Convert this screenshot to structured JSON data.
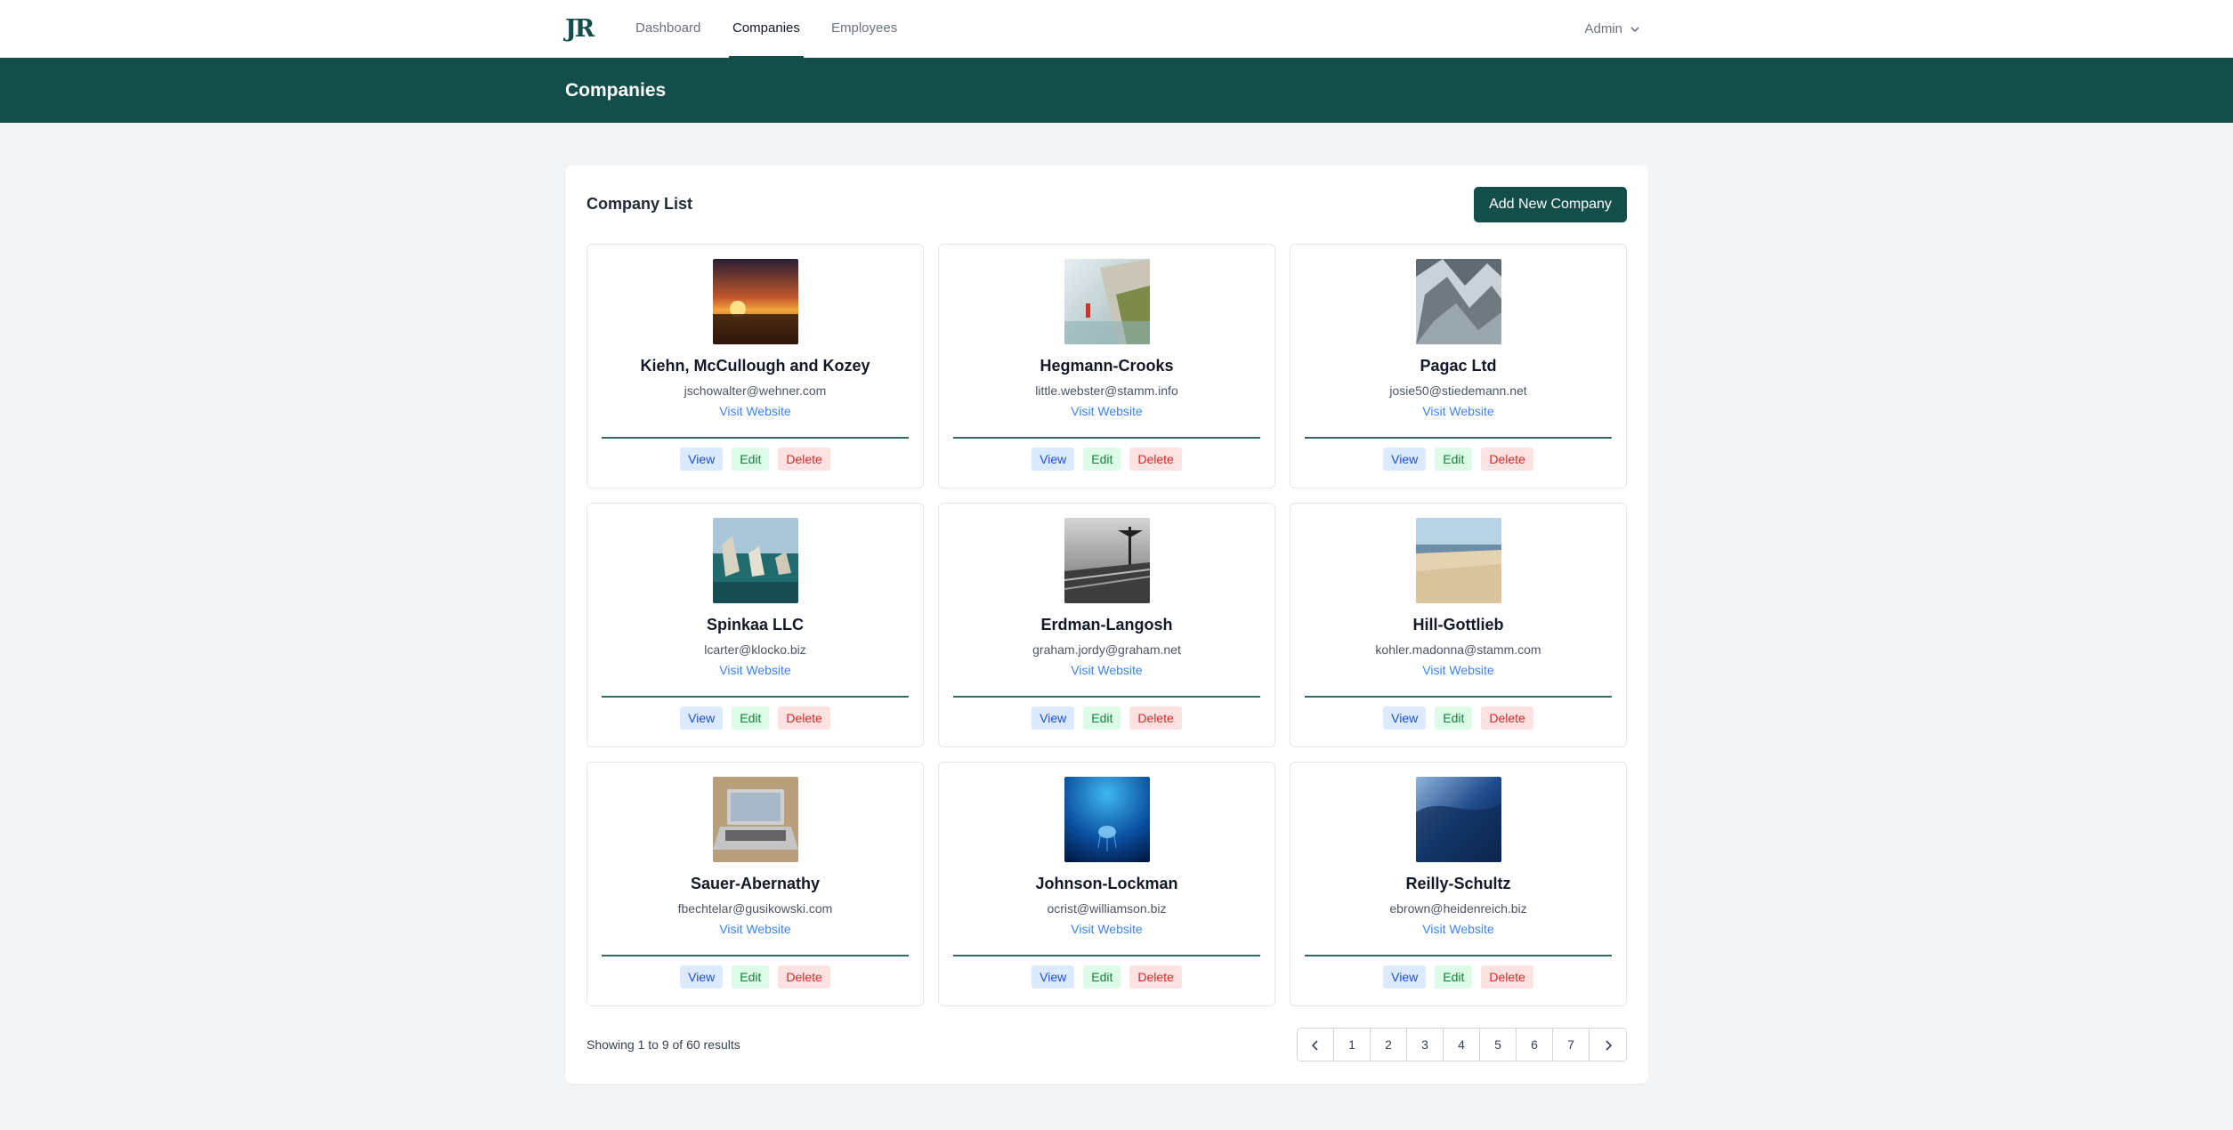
{
  "nav": {
    "logo": "JR",
    "links": [
      "Dashboard",
      "Companies",
      "Employees"
    ],
    "active": "Companies",
    "user": "Admin"
  },
  "header": {
    "title": "Companies"
  },
  "panel": {
    "title": "Company List",
    "add_button": "Add New Company",
    "cards": [
      {
        "name": "Kiehn, McCullough and Kozey",
        "email": "jschowalter@wehner.com",
        "link": "Visit Website",
        "image": "sunset-beach"
      },
      {
        "name": "Hegmann-Crooks",
        "email": "little.webster@stamm.info",
        "link": "Visit Website",
        "image": "cliff-lighthouse"
      },
      {
        "name": "Pagac Ltd",
        "email": "josie50@stiedemann.net",
        "link": "Visit Website",
        "image": "snowy-mountains"
      },
      {
        "name": "Spinkaa LLC",
        "email": "lcarter@klocko.biz",
        "link": "Visit Website",
        "image": "sea-rocks"
      },
      {
        "name": "Erdman-Langosh",
        "email": "graham.jordy@graham.net",
        "link": "Visit Website",
        "image": "pier-bw"
      },
      {
        "name": "Hill-Gottlieb",
        "email": "kohler.madonna@stamm.com",
        "link": "Visit Website",
        "image": "sandy-beach"
      },
      {
        "name": "Sauer-Abernathy",
        "email": "fbechtelar@gusikowski.com",
        "link": "Visit Website",
        "image": "laptop-desk"
      },
      {
        "name": "Johnson-Lockman",
        "email": "ocrist@williamson.biz",
        "link": "Visit Website",
        "image": "underwater-jellyfish"
      },
      {
        "name": "Reilly-Schultz",
        "email": "ebrown@heidenreich.biz",
        "link": "Visit Website",
        "image": "ocean-wave"
      }
    ],
    "actions": {
      "view": "View",
      "edit": "Edit",
      "delete": "Delete"
    }
  },
  "pagination": {
    "summary": "Showing 1 to 9 of 60 results",
    "pages": [
      "1",
      "2",
      "3",
      "4",
      "5",
      "6",
      "7"
    ],
    "prev_icon": "chevron-left-icon",
    "next_icon": "chevron-right-icon"
  },
  "colors": {
    "brand": "#134e4a",
    "link": "#3b82f6"
  }
}
